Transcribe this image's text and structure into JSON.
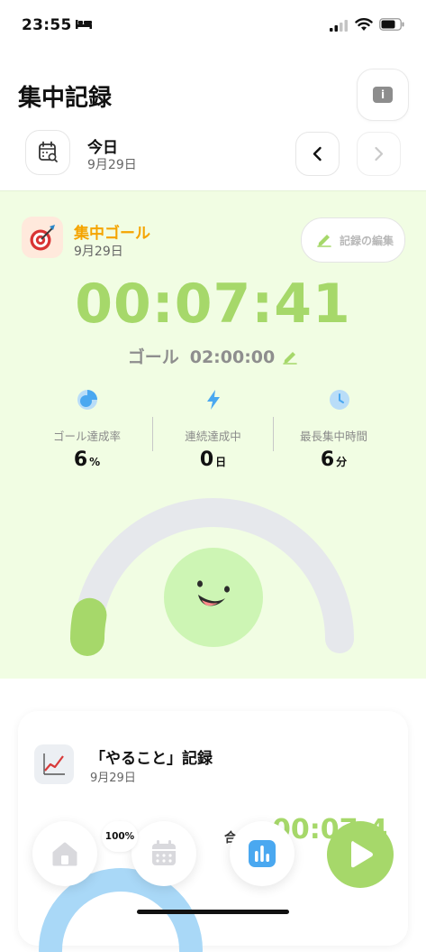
{
  "status_bar": {
    "time": "23:55"
  },
  "header": {
    "title": "集中記録",
    "info_icon": "i"
  },
  "date_nav": {
    "label": "今日",
    "date": "9月29日"
  },
  "focus_goal": {
    "title": "集中ゴール",
    "date": "9月29日",
    "edit_label": "記録の編集",
    "elapsed": "00:07:41",
    "goal_label": "ゴール",
    "goal_time": "02:00:00",
    "progress_fraction": 0.06
  },
  "stats": [
    {
      "label": "ゴール達成率",
      "value": "6",
      "unit": "%",
      "icon": "pie-chart-icon"
    },
    {
      "label": "連続達成中",
      "value": "0",
      "unit": "日",
      "icon": "lightning-icon"
    },
    {
      "label": "最長集中時間",
      "value": "6",
      "unit": "分",
      "icon": "clock-icon"
    }
  ],
  "todo_card": {
    "title": "「やること」記録",
    "date": "9月29日",
    "total_label": "合",
    "total_time": "00:07:4",
    "percent": "100%"
  },
  "colors": {
    "accent_green": "#a6d86a",
    "goal_orange": "#f5a400",
    "stat_blue": "#4aa8f0",
    "background_green": "#f1fde3"
  }
}
